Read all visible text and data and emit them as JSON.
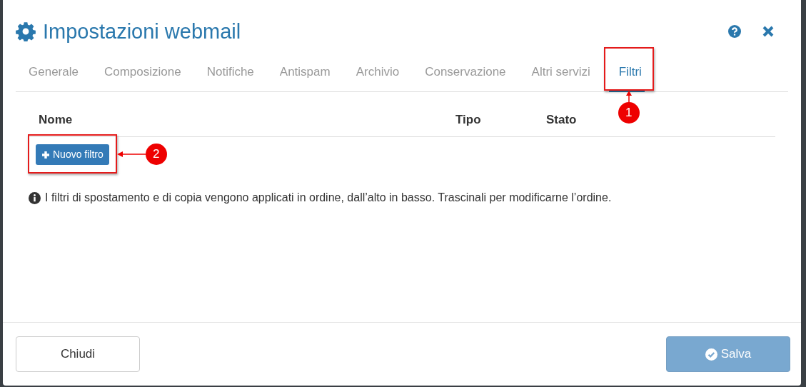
{
  "dialog": {
    "title": "Impostazioni webmail"
  },
  "tabs": [
    {
      "label": "Generale",
      "selected": false
    },
    {
      "label": "Composizione",
      "selected": false
    },
    {
      "label": "Notifiche",
      "selected": false
    },
    {
      "label": "Antispam",
      "selected": false
    },
    {
      "label": "Archivio",
      "selected": false
    },
    {
      "label": "Conservazione",
      "selected": false
    },
    {
      "label": "Altri servizi",
      "selected": false
    },
    {
      "label": "Filtri",
      "selected": true
    }
  ],
  "table": {
    "columns": [
      "Nome",
      "Tipo",
      "Stato"
    ]
  },
  "new_filter_button": {
    "label": "Nuovo filtro"
  },
  "info_text": "I filtri di spostamento e di copia vengono applicati in ordine, dall’alto in basso. Trascinali per modificarne l’ordine.",
  "footer": {
    "buttons": [
      {
        "label": "Chiudi",
        "kind": "default",
        "disabled": false
      },
      {
        "label": "Salva",
        "kind": "primary",
        "disabled": true
      }
    ]
  },
  "annotations": [
    {
      "number": "1",
      "kind": "tab"
    },
    {
      "number": "2",
      "kind": "button"
    }
  ]
}
